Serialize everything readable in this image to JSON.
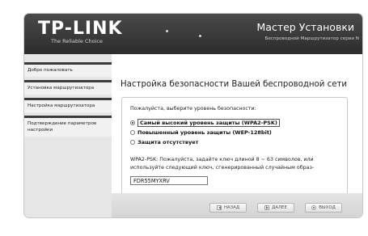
{
  "header": {
    "logo": "TP-LINK",
    "tagline": "The Reliable Choice",
    "title": "Мастер Установки",
    "subtitle": "Беспроводной Маршрутизатор серии N"
  },
  "sidebar": {
    "items": [
      {
        "label": "Добро пожаловать"
      },
      {
        "label": "Установка маршрутизатора"
      },
      {
        "label": "Настройка маршрутизатора"
      },
      {
        "label": "Подтверждение параметров настройки"
      }
    ]
  },
  "main": {
    "title": "Настройка безопасности Вашей беспроводной сети",
    "prompt": "Пожалуйста, выберите уровень безопасности:",
    "options": [
      {
        "label": "Самый высокий уровень защиты (WPA2-PSK)",
        "selected": true
      },
      {
        "label": "Повышенный уровень защиты (WEP-128bit)",
        "selected": false
      },
      {
        "label": "Защита отсутствует",
        "selected": false
      }
    ],
    "note": "WPA2-PSK: Пожалуйста, задайте ключ длиной 8 ~ 63 символов, или используйте следующий ключ, сгенерированный случайным образ-",
    "key_value": "FDR55MYXRV"
  },
  "footer": {
    "back_label": "НАЗАД",
    "next_label": "ДАЛЕЕ",
    "exit_label": "ВЫХОД"
  }
}
